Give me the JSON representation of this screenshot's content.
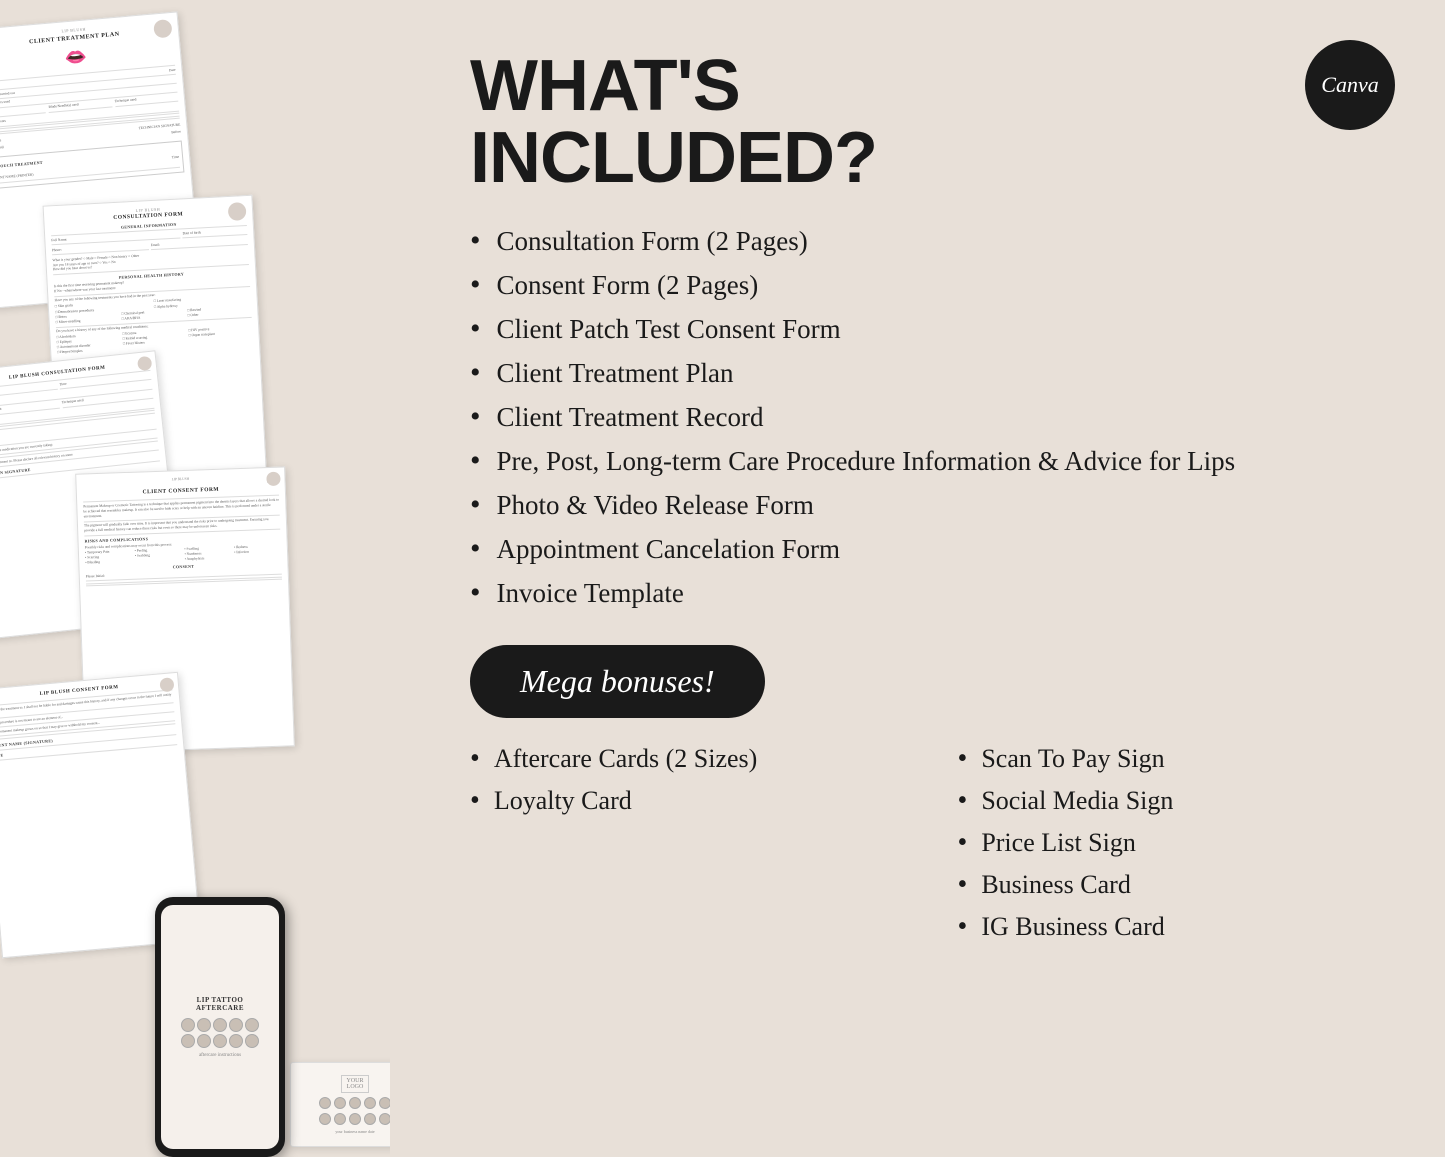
{
  "page": {
    "background_color": "#e8e0d8"
  },
  "canva_badge": {
    "text": "Canva"
  },
  "heading": {
    "line1": "WHAT'S",
    "line2": "INCLUDED?"
  },
  "main_items": [
    {
      "id": 1,
      "text": "Consultation Form (2 Pages)"
    },
    {
      "id": 2,
      "text": "Consent Form (2 Pages)"
    },
    {
      "id": 3,
      "text": "Client Patch Test Consent Form"
    },
    {
      "id": 4,
      "text": "Client Treatment Plan"
    },
    {
      "id": 5,
      "text": "Client Treatment Record"
    },
    {
      "id": 6,
      "text": "Pre, Post, Long-term Care Procedure Information & Advice for Lips"
    },
    {
      "id": 7,
      "text": "Photo & Video Release Form"
    },
    {
      "id": 8,
      "text": "Appointment Cancelation Form"
    },
    {
      "id": 9,
      "text": "Invoice Template"
    }
  ],
  "mega_bonuses_label": "Mega bonuses!",
  "bonus_col1": [
    {
      "id": 1,
      "text": "Aftercare Cards (2 Sizes)"
    },
    {
      "id": 2,
      "text": "Loyalty Card"
    }
  ],
  "bonus_col2": [
    {
      "id": 1,
      "text": "Scan To Pay Sign"
    },
    {
      "id": 2,
      "text": "Social Media Sign"
    },
    {
      "id": 3,
      "text": "Price List Sign"
    },
    {
      "id": 4,
      "text": "Business Card"
    },
    {
      "id": 5,
      "text": "IG Business Card"
    }
  ],
  "documents": {
    "doc1_title": "CLIENT TREATMENT PLAN",
    "doc1_subtitle": "LIP BLUSH",
    "doc2_title": "CONSULTATION FORM",
    "doc2_subtitle": "LIP BLUSH",
    "doc3_title": "LIP BLUSH CONSULTATION FORM",
    "doc4_title": "CLIENT CONSENT FORM",
    "doc4_subtitle": "LIP BLUSH",
    "doc5_title": "LIP BLUSH CONSENT FORM"
  }
}
